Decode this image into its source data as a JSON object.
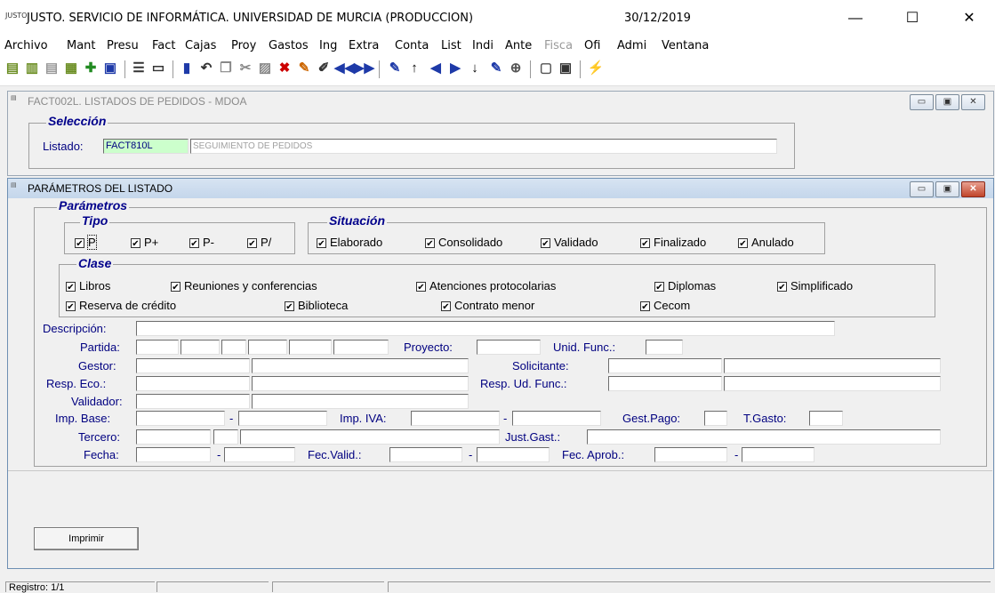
{
  "app": {
    "title": "JUSTO. SERVICIO DE INFORMÁTICA. UNIVERSIDAD DE MURCIA (PRODUCCION)",
    "date": "30/12/2019",
    "icon_text": "JUSTO"
  },
  "window_controls": {
    "minimize": "—",
    "maximize": "☐",
    "close": "✕"
  },
  "menu": [
    "Archivo",
    "Mant",
    "Presu",
    "Fact",
    "Cajas",
    "Proy",
    "Gastos",
    "Ing",
    "Extra",
    "Conta",
    "List",
    "Indi",
    "Ante",
    "Fisca",
    "Ofi",
    "Admi",
    "Ventana"
  ],
  "toolbar_icons": [
    "folder-icon",
    "folder-open-icon",
    "folder-gray-icon",
    "folder-arrow-icon",
    "insert-record-icon",
    "save-icon",
    "list-icon",
    "print-icon",
    "exit-icon",
    "undo-icon",
    "copy-icon",
    "cut-icon",
    "paste-icon",
    "delete-record-icon",
    "clear-icon",
    "edit-icon",
    "first-record-icon",
    "last-record-icon",
    "query-icon",
    "up-arrow-icon",
    "previous-icon",
    "next-icon",
    "down-arrow-icon",
    "search-icon",
    "calendar-icon",
    "keyboard-icon",
    "action-icon"
  ],
  "window1": {
    "title": "FACT002L. LISTADOS DE PEDIDOS - MDOA",
    "group_label": "Selección",
    "listado_label": "Listado:",
    "listado_code": "FACT810L",
    "listado_desc": "SEGUIMIENTO DE PEDIDOS"
  },
  "window2": {
    "title": "PARÁMETROS DEL LISTADO",
    "group_parametros": "Parámetros",
    "group_tipo": "Tipo",
    "tipo": [
      "P",
      "P+",
      "P-",
      "P/"
    ],
    "group_situacion": "Situación",
    "situacion": [
      "Elaborado",
      "Consolidado",
      "Validado",
      "Finalizado",
      "Anulado"
    ],
    "group_clase": "Clase",
    "clase_row1": [
      "Libros",
      "Reuniones y conferencias",
      "Atenciones protocolarias",
      "Diplomas",
      "Simplificado"
    ],
    "clase_row2": [
      "Reserva de crédito",
      "Biblioteca",
      "Contrato menor",
      "Cecom"
    ],
    "labels": {
      "descripcion": "Descripción:",
      "partida": "Partida:",
      "proyecto": "Proyecto:",
      "unid_func": "Unid. Func.:",
      "gestor": "Gestor:",
      "solicitante": "Solicitante:",
      "resp_eco": "Resp. Eco.:",
      "resp_ud_func": "Resp. Ud. Func.:",
      "validador": "Validador:",
      "imp_base": "Imp. Base:",
      "imp_iva": "Imp. IVA:",
      "gest_pago": "Gest.Pago:",
      "t_gasto": "T.Gasto:",
      "tercero": "Tercero:",
      "just_gast": "Just.Gast.:",
      "fecha": "Fecha:",
      "fec_valid": "Fec.Valid.:",
      "fec_aprob": "Fec. Aprob.:"
    },
    "dash": "-",
    "check_mark": "✔",
    "print_button": "Imprimir"
  },
  "status": {
    "registro": "Registro: 1/1"
  }
}
